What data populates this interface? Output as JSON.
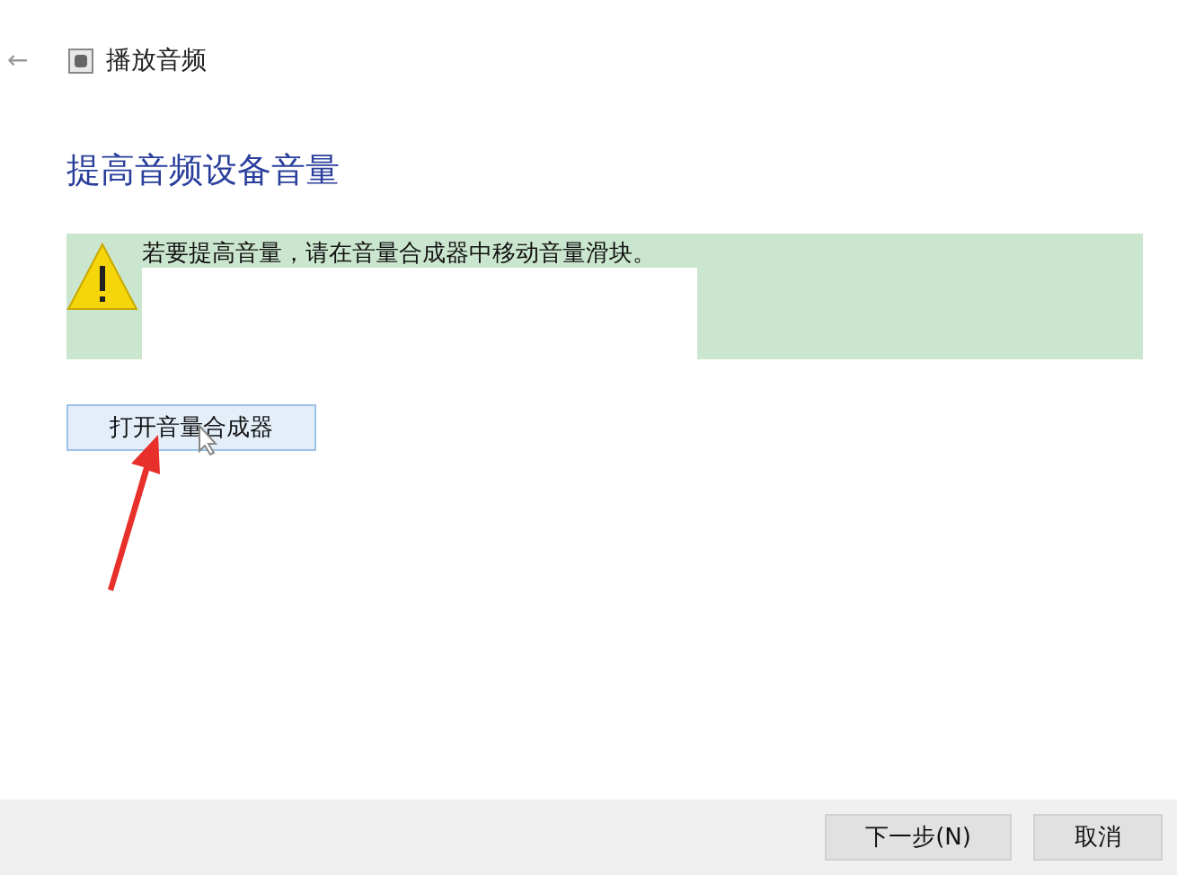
{
  "header": {
    "back": "←",
    "title": "播放音频"
  },
  "heading": "提高音频设备音量",
  "notice": {
    "text": "若要提高音量，请在音量合成器中移动音量滑块。"
  },
  "action_button": "打开音量合成器",
  "footer_buttons": [
    "下一步(N)",
    "取消"
  ]
}
